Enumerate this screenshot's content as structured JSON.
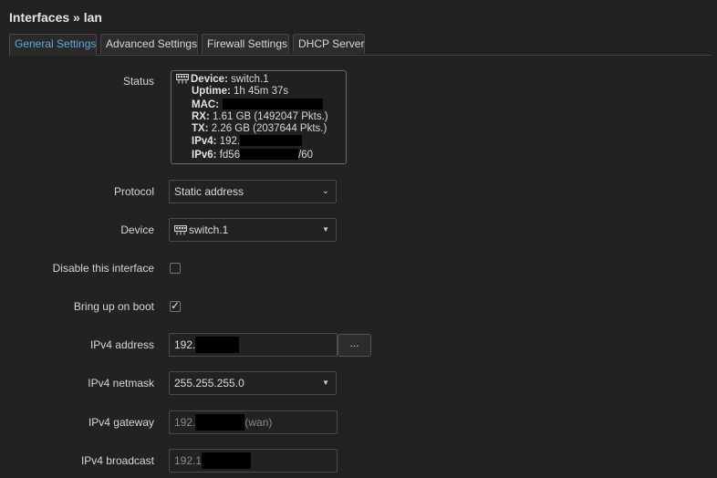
{
  "page": {
    "title": "Interfaces » lan"
  },
  "tabs": [
    {
      "label": "General Settings",
      "active": true
    },
    {
      "label": "Advanced Settings",
      "active": false
    },
    {
      "label": "Firewall Settings",
      "active": false
    },
    {
      "label": "DHCP Server",
      "active": false
    }
  ],
  "status": {
    "label": "Status",
    "device_key": "Device:",
    "device_value": "switch.1",
    "uptime_key": "Uptime:",
    "uptime_value": "1h 45m 37s",
    "mac_key": "MAC:",
    "rx_key": "RX:",
    "rx_value": "1.61 GB (1492047 Pkts.)",
    "tx_key": "TX:",
    "tx_value": "2.26 GB (2037644 Pkts.)",
    "ipv4_key": "IPv4:",
    "ipv4_value": "192.",
    "ipv6_key": "IPv6:",
    "ipv6_value_prefix": "fd56",
    "ipv6_value_suffix": "/60"
  },
  "protocol": {
    "label": "Protocol",
    "value": "Static address"
  },
  "device": {
    "label": "Device",
    "value": "switch.1"
  },
  "disable_interface": {
    "label": "Disable this interface",
    "checked": false
  },
  "bring_up_on_boot": {
    "label": "Bring up on boot",
    "checked": true,
    "tick": "✓"
  },
  "ipv4_address": {
    "label": "IPv4 address",
    "value": "192.",
    "more_label": "..."
  },
  "ipv4_netmask": {
    "label": "IPv4 netmask",
    "value": "255.255.255.0"
  },
  "ipv4_gateway": {
    "label": "IPv4 gateway",
    "placeholder_prefix": "192.",
    "placeholder_suffix": "(wan)"
  },
  "ipv4_broadcast": {
    "label": "IPv4 broadcast",
    "placeholder_prefix": "192.1"
  },
  "glyphs": {
    "chevron": "⌄",
    "caret": "▼"
  },
  "icons": {
    "device": "network-switch-icon"
  }
}
